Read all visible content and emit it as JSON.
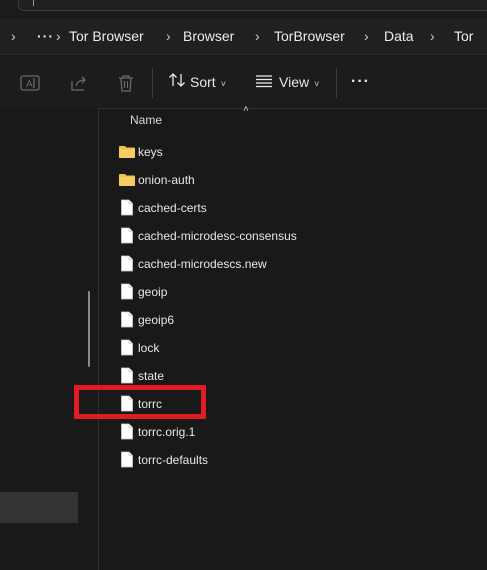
{
  "breadcrumb": {
    "more_label": "···",
    "items": [
      "Tor Browser",
      "Browser",
      "TorBrowser",
      "Data",
      "Tor"
    ]
  },
  "toolbar": {
    "rename_icon": "rename-icon",
    "share_icon": "share-icon",
    "delete_icon": "trash-icon",
    "sort_label": "Sort",
    "view_label": "View",
    "more_label": "···"
  },
  "column": {
    "name_header": "Name"
  },
  "files": [
    {
      "name": "keys",
      "type": "folder"
    },
    {
      "name": "onion-auth",
      "type": "folder"
    },
    {
      "name": "cached-certs",
      "type": "file"
    },
    {
      "name": "cached-microdesc-consensus",
      "type": "file"
    },
    {
      "name": "cached-microdescs.new",
      "type": "file"
    },
    {
      "name": "geoip",
      "type": "file"
    },
    {
      "name": "geoip6",
      "type": "file"
    },
    {
      "name": "lock",
      "type": "file"
    },
    {
      "name": "state",
      "type": "file"
    },
    {
      "name": "torrc",
      "type": "file",
      "highlighted": true
    },
    {
      "name": "torrc.orig.1",
      "type": "file"
    },
    {
      "name": "torrc-defaults",
      "type": "file"
    }
  ],
  "colors": {
    "highlight_border": "#e11b22",
    "folder": "#f2c14e",
    "background": "#191919"
  }
}
